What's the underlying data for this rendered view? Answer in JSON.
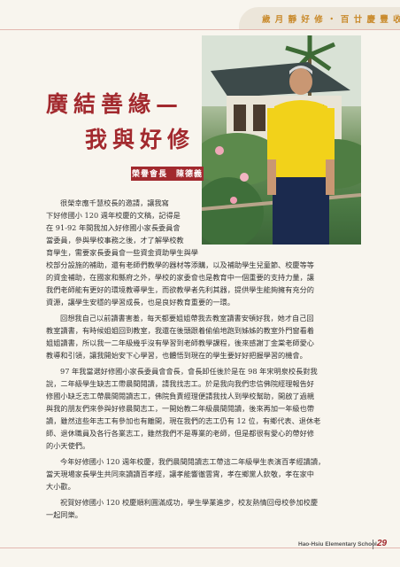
{
  "header": {
    "text": "歲 月 靜 好 修 ‧ 百 廿 慶 豐 收"
  },
  "title": {
    "line1": "廣結善緣—",
    "line2": "我與好修"
  },
  "author": "榮譽會長　陳德義",
  "body_lines": [
    "很榮幸應千慧校長的邀請，讓我寫",
    "下好修國小 120 週年校慶的文稿，記得是",
    "在 91-92 年間我加入好修國小家長委員會",
    "當委員，參與學校事務之後，才了解學校教",
    "育學生，需要家長委員會一些資金資助學生與學",
    "校部分設施的補助，還有老師們教學的器材等添購，以及補助學生兒童節、校慶等等",
    "的資金補助，在國家和縣府之外，學校的家委會也是教育中一個重要的支持力量，讓",
    "我們老師能有更好的環境教導學生，而欲教學者先利其器，提供學生能夠擁有充分的",
    "資源，讓學生安穩的學習成長，也是良好教育重要的一環。",
    "回想我自己以前讀書害羞，每天都要姐姐帶我去教室讀書安頓好我，她才自己回",
    "教室讀書，有時候姐姐回到教室，我還在後頭跟着偷偷地跑到姊姊的教室外門窗看着",
    "姐姐讀書，所以我一二年級幾乎沒有學習到老師教學課程，後來感謝丁金棠老師愛心",
    "教導和引領，讓我開始安下心學習，也體悟到現在的學生要好好把握學習的機會。",
    "97 年我當選好修國小家長委員會會長，會長卸任後於是在 98 年宋明泉校長對我",
    "說，二年級學生缺志工帶晨間閱讀，請我找志工。於是我向我們忠信佛院經理報告好",
    "修國小缺乏志工帶晨間閱讀志工，佛院負責經理便請我找人到學校幫助，開啟了過親",
    "與我的朋友們來參與好修晨間志工，一開始教二年級晨間閱讀，後來再加一年級也帶",
    "讀，雖然這些年志工有參加也有離開，現在我們的志工仍有 12 位，有鄉代表、退休老",
    "師、退休職員及各行各業志工，雖然我們不是專業的老師，但是都很有愛心的帶好修",
    "的小天使們。",
    "今年好修國小 120 週年校慶，我們晨間閱讀志工帶這二年級學生表演百孝經讀讀，",
    "當天現場家長學生共同來讀讀百孝經，讓孝能響徹雲霄，孝在鄉黨人欽敬，孝在家中",
    "大小歡。",
    "祝賀好修國小 120 校慶順利圓滿成功，學生學業進步，校友熱情回母校參加校慶",
    "一起同樂。"
  ],
  "footer": {
    "school": "Hao-Hsiu Elementary School",
    "page": "29"
  }
}
